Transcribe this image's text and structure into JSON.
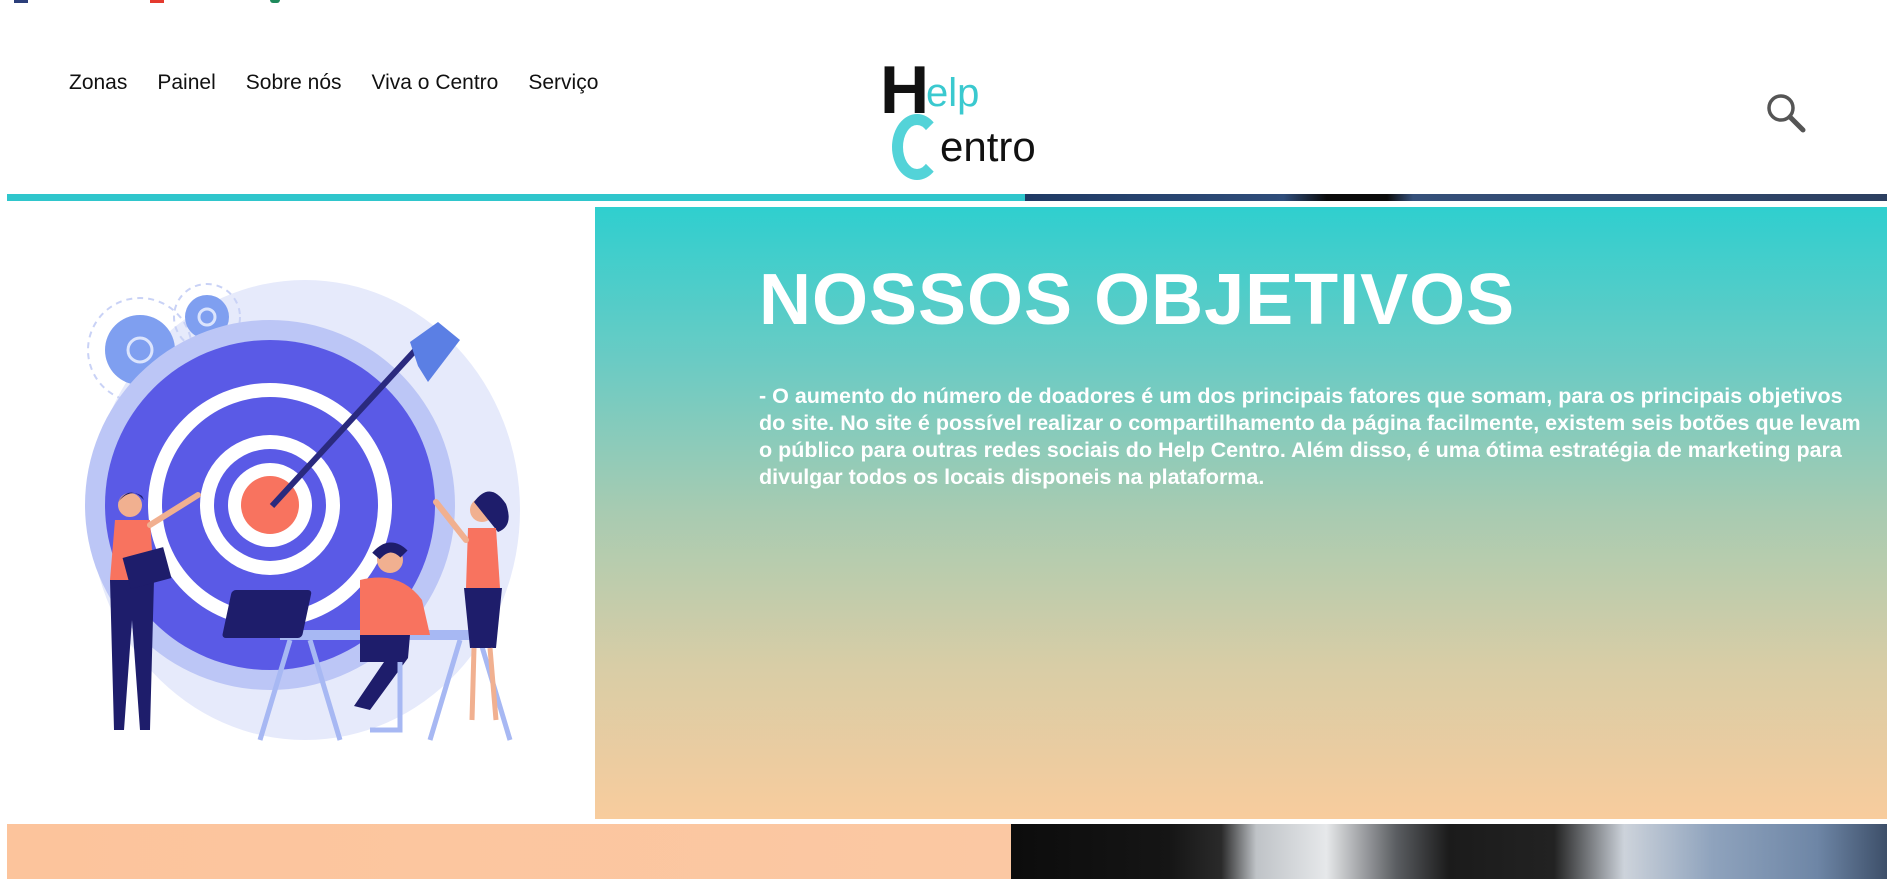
{
  "nav": {
    "items": [
      "Zonas",
      "Painel",
      "Sobre nós",
      "Viva o Centro",
      "Serviço"
    ]
  },
  "logo": {
    "help_h": "H",
    "help_rest": "elp",
    "centro_rest": "entro"
  },
  "objectives": {
    "title": "NOSSOS OBJETIVOS",
    "text": "- O aumento do número de doadores é um dos principais fatores que somam, para os principais objetivos do site. No site é possível realizar o compartilhamento da página facilmente, existem seis botões que levam o público para outras redes sociais do Help Centro. Além disso, é uma ótima estratégia de marketing para divulgar todos os locais disponeis na plataforma."
  },
  "icons": {
    "search": "search-icon",
    "illustration": "target-goal-illustration"
  },
  "colors": {
    "teal": "#2fc6cc",
    "peach": "#fcc49c",
    "target_blue": "#5a5ae6",
    "accent_coral": "#f8735f",
    "navy": "#1e1d6b"
  }
}
